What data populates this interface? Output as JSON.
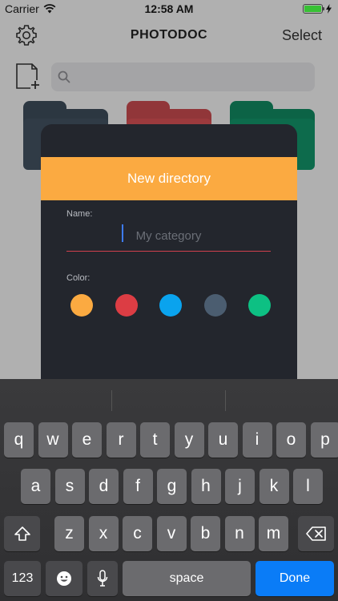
{
  "status_bar": {
    "carrier": "Carrier",
    "time": "12:58 AM",
    "battery_level": 1.0
  },
  "nav": {
    "title": "PHOTODOC",
    "select_label": "Select"
  },
  "search": {
    "placeholder": ""
  },
  "folders": [
    {
      "color": "#3e4d5b"
    },
    {
      "color": "#c94b4f"
    },
    {
      "color": "#118a62"
    }
  ],
  "dialog": {
    "title": "New directory",
    "name_label": "Name:",
    "name_placeholder": "My category",
    "name_value": "",
    "color_label": "Color:",
    "colors": [
      "#fbaa41",
      "#dc3d44",
      "#0aa3ee",
      "#4b5d70",
      "#0dc083"
    ]
  },
  "keyboard": {
    "row1": [
      "q",
      "w",
      "e",
      "r",
      "t",
      "y",
      "u",
      "i",
      "o",
      "p"
    ],
    "row2": [
      "a",
      "s",
      "d",
      "f",
      "g",
      "h",
      "j",
      "k",
      "l"
    ],
    "row3": [
      "z",
      "x",
      "c",
      "v",
      "b",
      "n",
      "m"
    ],
    "numbers_label": "123",
    "space_label": "space",
    "done_label": "Done"
  }
}
